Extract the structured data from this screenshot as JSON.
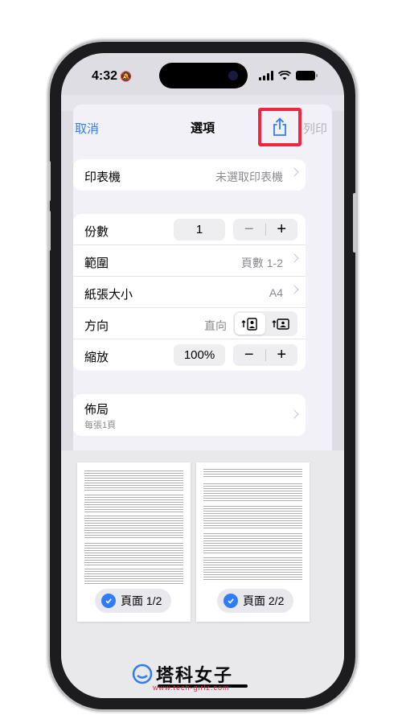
{
  "status_bar": {
    "time": "4:32"
  },
  "nav": {
    "cancel": "取消",
    "title": "選項",
    "print": "列印"
  },
  "printer": {
    "label": "印表機",
    "value": "未選取印表機"
  },
  "options": {
    "copies": {
      "label": "份數",
      "value": "1",
      "minus": "−",
      "plus": "+"
    },
    "range": {
      "label": "範圍",
      "value": "頁數 1-2"
    },
    "paper": {
      "label": "紙張大小",
      "value": "A4"
    },
    "orientation": {
      "label": "方向",
      "value": "直向"
    },
    "scale": {
      "label": "縮放",
      "value": "100%",
      "minus": "−",
      "plus": "+"
    }
  },
  "layout": {
    "label": "佈局",
    "sub": "每張1頁"
  },
  "previews": [
    {
      "label": "頁面 1/2"
    },
    {
      "label": "頁面 2/2"
    }
  ],
  "watermark": {
    "text": "塔科女子",
    "url": "www.tech-girlz.com"
  },
  "colors": {
    "accent": "#2f7cf6",
    "highlight": "#f0263f",
    "sheet": "#f2f1f7"
  }
}
